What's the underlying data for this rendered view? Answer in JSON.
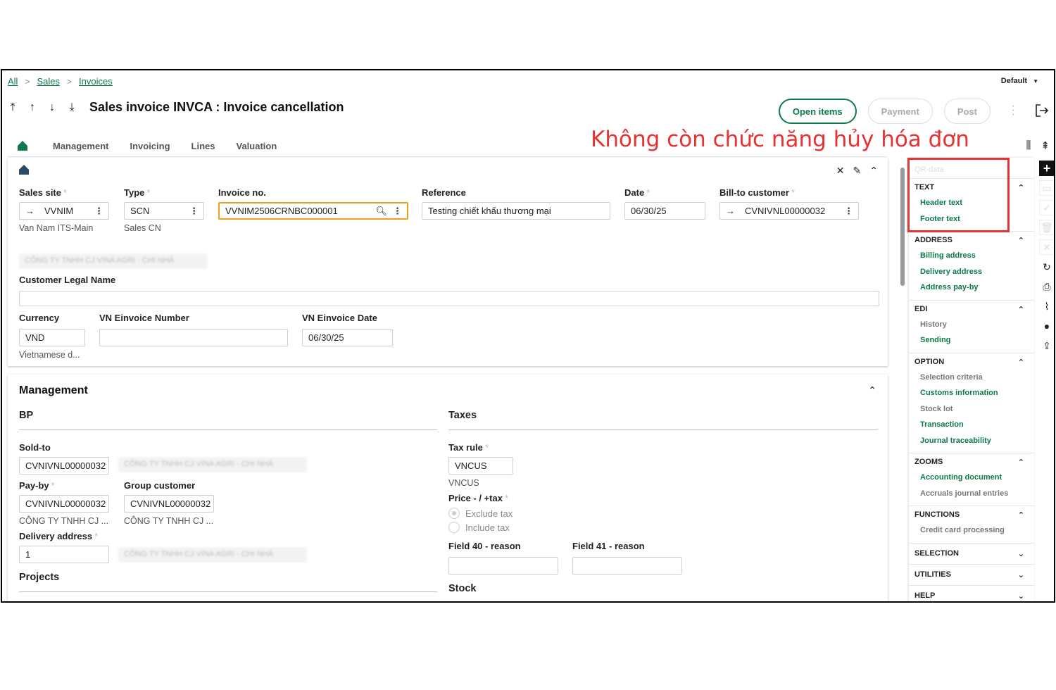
{
  "breadcrumb": {
    "all": "All",
    "sales": "Sales",
    "invoices": "Invoices"
  },
  "default_selector": "Default",
  "title": "Sales invoice INVCA : Invoice cancellation",
  "buttons": {
    "open_items": "Open items",
    "payment": "Payment",
    "post": "Post"
  },
  "tabs": [
    "Management",
    "Invoicing",
    "Lines",
    "Valuation"
  ],
  "annotation": "Không còn chức năng hủy hóa đơn",
  "header": {
    "sales_site": {
      "label": "Sales site",
      "value": "VVNIM",
      "sub": "Van Nam ITS-Main"
    },
    "type": {
      "label": "Type",
      "value": "SCN",
      "sub": "Sales CN"
    },
    "invoice_no": {
      "label": "Invoice no.",
      "value": "VVNIM2506CRNBC000001"
    },
    "reference": {
      "label": "Reference",
      "value": "Testing chiết khấu thương mại"
    },
    "date": {
      "label": "Date",
      "value": "06/30/25"
    },
    "bill_to": {
      "label": "Bill-to customer",
      "value": "CVNIVNL00000032"
    },
    "blurred_name": "CÔNG TY TNHH CJ VINA AGRI - CHI NHÁ",
    "legal_name": {
      "label": "Customer Legal Name",
      "value": ""
    },
    "currency": {
      "label": "Currency",
      "value": "VND",
      "sub": "Vietnamese d..."
    },
    "einvoice_number": {
      "label": "VN Einvoice Number",
      "value": ""
    },
    "einvoice_date": {
      "label": "VN Einvoice Date",
      "value": "06/30/25"
    }
  },
  "management": {
    "title": "Management",
    "bp": "BP",
    "sold_to": {
      "label": "Sold-to",
      "value": "CVNIVNL00000032"
    },
    "pay_by": {
      "label": "Pay-by",
      "value": "CVNIVNL00000032",
      "sub": "CÔNG TY TNHH CJ ..."
    },
    "group_customer": {
      "label": "Group customer",
      "value": "CVNIVNL00000032",
      "sub": "CÔNG TY TNHH CJ ..."
    },
    "delivery_address": {
      "label": "Delivery address",
      "value": "1"
    },
    "projects": "Projects",
    "taxes": "Taxes",
    "tax_rule": {
      "label": "Tax rule",
      "value": "VNCUS",
      "sub": "VNCUS"
    },
    "price_tax": {
      "label": "Price - / +tax",
      "exclude": "Exclude tax",
      "include": "Include tax"
    },
    "field40": {
      "label": "Field 40 - reason",
      "value": ""
    },
    "field41": {
      "label": "Field 41 - reason",
      "value": ""
    },
    "stock": "Stock"
  },
  "side_panel": {
    "qr": "QR-data",
    "sections": [
      {
        "name": "TEXT",
        "links": [
          {
            "label": "Header text",
            "enabled": true
          },
          {
            "label": "Footer text",
            "enabled": true
          }
        ]
      },
      {
        "name": "ADDRESS",
        "links": [
          {
            "label": "Billing address",
            "enabled": true
          },
          {
            "label": "Delivery address",
            "enabled": true
          },
          {
            "label": "Address pay-by",
            "enabled": true
          }
        ]
      },
      {
        "name": "EDI",
        "links": [
          {
            "label": "History",
            "enabled": false
          },
          {
            "label": "Sending",
            "enabled": true
          }
        ]
      },
      {
        "name": "OPTION",
        "links": [
          {
            "label": "Selection criteria",
            "enabled": false
          },
          {
            "label": "Customs information",
            "enabled": true
          },
          {
            "label": "Stock lot",
            "enabled": false
          },
          {
            "label": "Transaction",
            "enabled": true
          },
          {
            "label": "Journal traceability",
            "enabled": true
          }
        ]
      },
      {
        "name": "ZOOMS",
        "links": [
          {
            "label": "Accounting document",
            "enabled": true
          },
          {
            "label": "Accruals journal entries",
            "enabled": false
          }
        ]
      },
      {
        "name": "FUNCTIONS",
        "links": [
          {
            "label": "Credit card processing",
            "enabled": false
          }
        ]
      },
      {
        "name": "SELECTION",
        "links": []
      },
      {
        "name": "UTILITIES",
        "links": []
      },
      {
        "name": "HELP",
        "links": []
      }
    ]
  },
  "colors": {
    "accent": "#0d7a4a",
    "annotation": "#e53232",
    "focus": "#e8a317"
  }
}
